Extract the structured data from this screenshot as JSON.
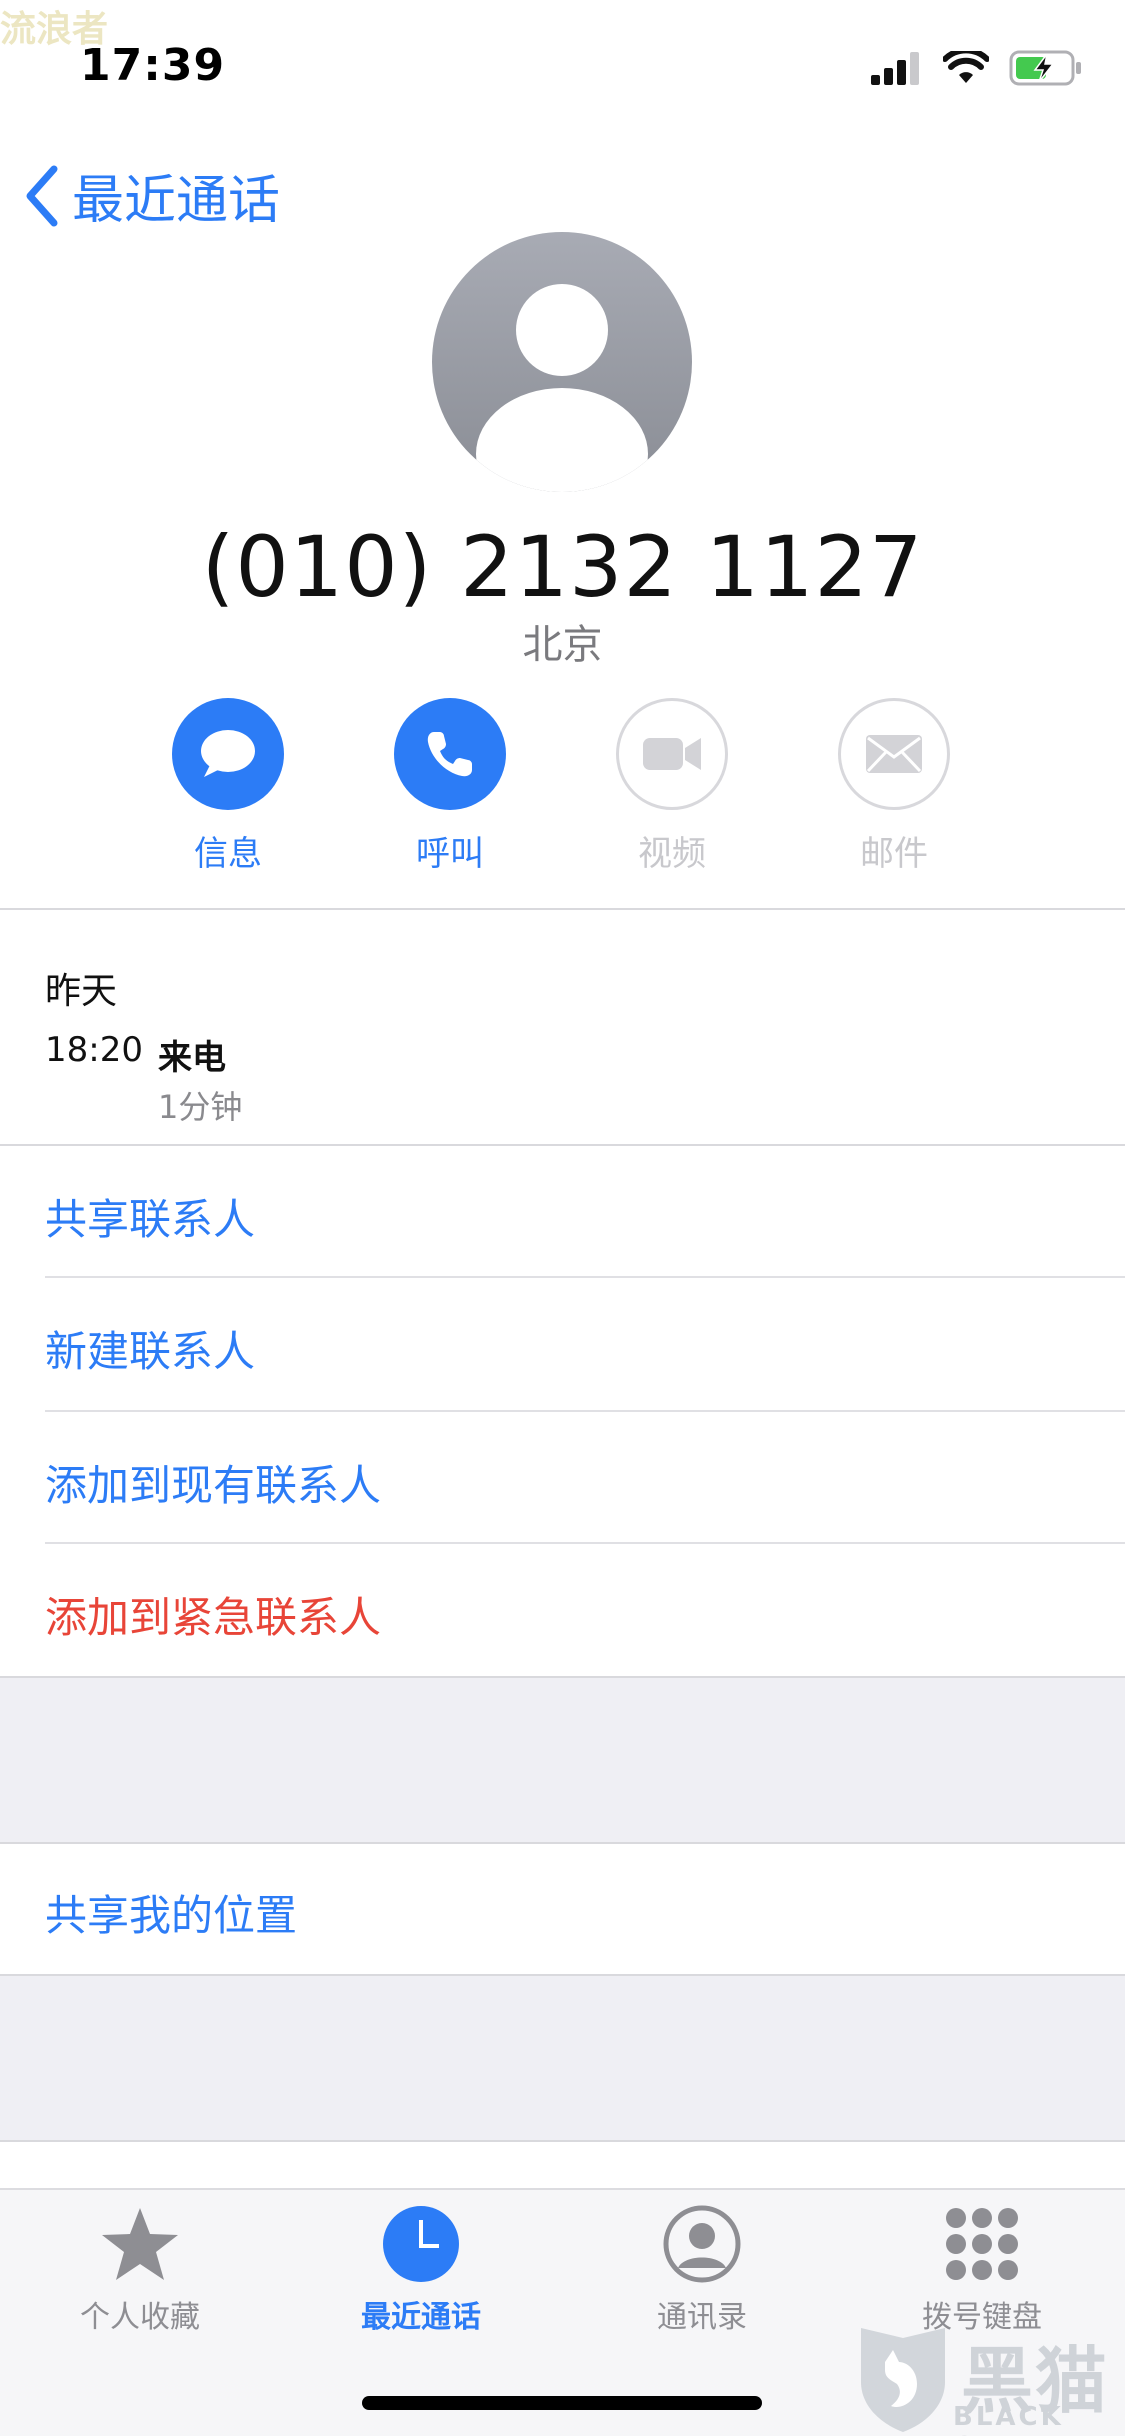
{
  "watermark_top": "流浪者",
  "status_bar": {
    "time": "17:39",
    "icons": [
      "signal-icon",
      "wifi-icon",
      "battery-charging-icon"
    ]
  },
  "nav": {
    "back_label": "最近通话"
  },
  "contact": {
    "number": "(010) 2132 1127",
    "location": "北京"
  },
  "actions": [
    {
      "label": "信息",
      "icon": "message-icon",
      "enabled": true
    },
    {
      "label": "呼叫",
      "icon": "phone-icon",
      "enabled": true
    },
    {
      "label": "视频",
      "icon": "video-icon",
      "enabled": false
    },
    {
      "label": "邮件",
      "icon": "mail-icon",
      "enabled": false
    }
  ],
  "history": {
    "day": "昨天",
    "time": "18:20",
    "type": "来电",
    "duration": "1分钟"
  },
  "options": {
    "share_contact": "共享联系人",
    "new_contact": "新建联系人",
    "add_existing": "添加到现有联系人",
    "add_emergency": "添加到紧急联系人",
    "share_location": "共享我的位置"
  },
  "tabs": [
    {
      "label": "个人收藏",
      "icon": "star-icon",
      "active": false
    },
    {
      "label": "最近通话",
      "icon": "clock-icon",
      "active": true
    },
    {
      "label": "通讯录",
      "icon": "contact-icon",
      "active": false
    },
    {
      "label": "拨号键盘",
      "icon": "keypad-icon",
      "active": false
    }
  ],
  "watermark_brand": {
    "main": "黑猫",
    "sub": "BLACK CAT"
  },
  "colors": {
    "accent": "#2c7cf6",
    "danger": "#e84538",
    "disabled": "#c8c8cc",
    "band": "#efeff4"
  }
}
